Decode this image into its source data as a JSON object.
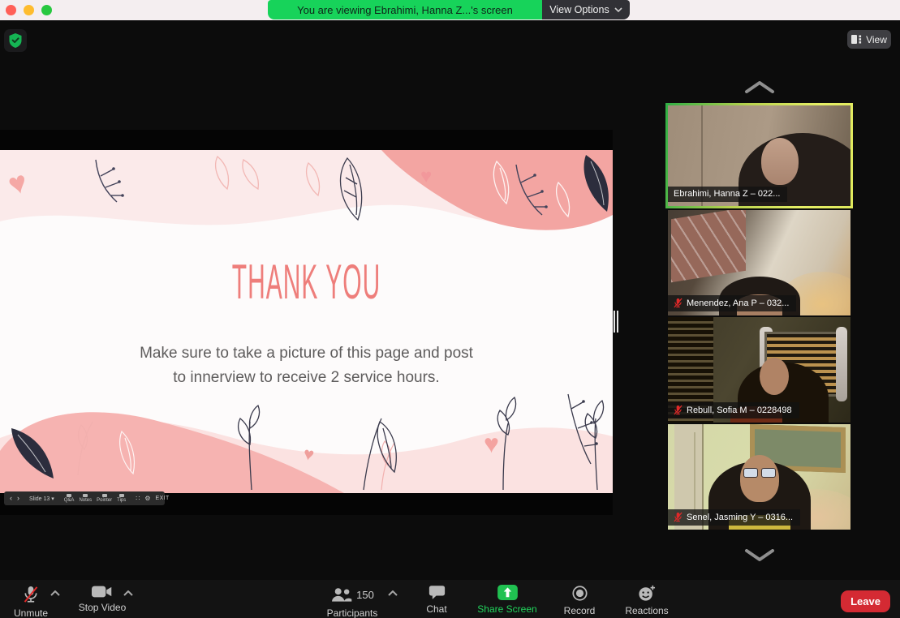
{
  "menu_bar": {
    "viewing_banner": "You are viewing Ebrahimi, Hanna Z...'s screen",
    "view_options": "View Options"
  },
  "top_controls": {
    "view_button": "View"
  },
  "shared_screen": {
    "slide": {
      "title": "Thank you",
      "body_line1": "Make sure to take a picture of this page and post",
      "body_line2": "to innerview to receive 2 service hours."
    },
    "presenter_bar": {
      "prev": "‹",
      "next": "›",
      "slide_selector": "Slide 13  ▾",
      "items": [
        "Q&A",
        "Notes",
        "Pointer",
        "Tips"
      ],
      "grid_glyph": "∷",
      "settings_glyph": "⚙",
      "exit": "EXIT"
    }
  },
  "participants_panel": {
    "tiles": [
      {
        "name": "Ebrahimi, Hanna Z – 022...",
        "muted": false,
        "active": true
      },
      {
        "name": "Menendez, Ana P – 032...",
        "muted": true,
        "active": false
      },
      {
        "name": "Rebull, Sofia M – 0228498",
        "muted": true,
        "active": false
      },
      {
        "name": "Senel, Jasming Y – 0316...",
        "muted": true,
        "active": false
      }
    ]
  },
  "control_bar": {
    "unmute": "Unmute",
    "stop_video": "Stop Video",
    "participants": "Participants",
    "participants_count": "150",
    "chat": "Chat",
    "share_screen": "Share Screen",
    "record": "Record",
    "reactions": "Reactions",
    "leave": "Leave"
  },
  "colors": {
    "banner_green": "#17d35a",
    "share_green": "#20c151",
    "leave_red": "#d42a33",
    "active_border_yellow_green": "#dfe95c",
    "muted_red": "#e02828",
    "slide_accent": "#ee7e7b"
  }
}
